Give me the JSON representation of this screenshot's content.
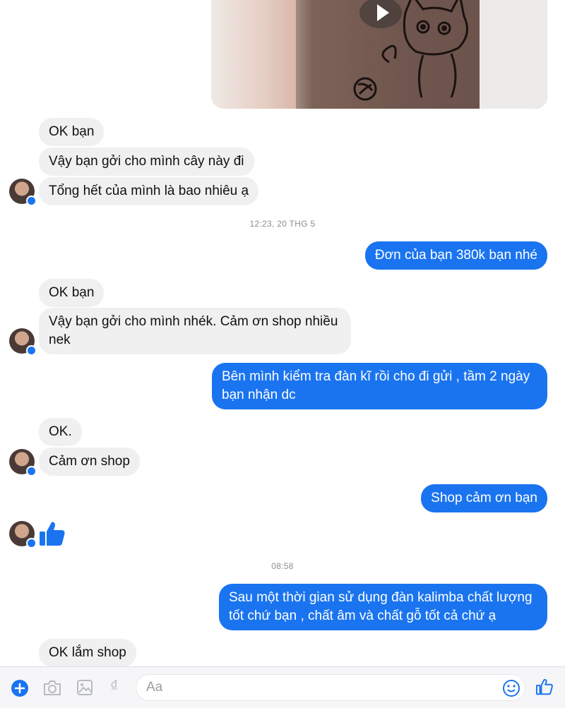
{
  "timestamps": [
    "12:23, 20 THG 5",
    "08:58"
  ],
  "messages": [
    {
      "text": "OK bạn"
    },
    {
      "text": "Vậy bạn gởi cho mình cây này đi"
    },
    {
      "text": "Tổng hết của mình là bao nhiêu ạ"
    },
    {
      "text": "Đơn của bạn 380k bạn nhé"
    },
    {
      "text": "OK bạn"
    },
    {
      "text": "Vậy bạn gởi cho mình nhék. Cảm ơn shop nhiều nek"
    },
    {
      "text": "Bên mình kiểm tra đàn kĩ rồi cho đi gửi , tầm 2 ngày bạn nhận dc"
    },
    {
      "text": "OK."
    },
    {
      "text": "Cảm ơn shop"
    },
    {
      "text": "Shop cảm ơn bạn"
    },
    {
      "text": "Sau một thời gian sử dụng đàn kalimba chất lượng tốt chứ bạn , chất âm và chất gỗ tốt cả chứ ạ"
    },
    {
      "text": "OK lắm shop"
    }
  ],
  "composer": {
    "placeholder": "Aa",
    "currency_symbol": "₫"
  },
  "icons": {
    "add": "plus-circle-icon",
    "camera": "camera-icon",
    "gallery": "image-icon",
    "payment": "dong-icon",
    "emoji": "smiley-icon",
    "like": "thumbs-up-icon",
    "play": "play-icon",
    "messenger_badge": "messenger-badge-icon"
  },
  "colors": {
    "outgoing_bubble": "#1a74f0",
    "incoming_bubble": "#f1f0f0",
    "accent": "#1a74f0"
  }
}
